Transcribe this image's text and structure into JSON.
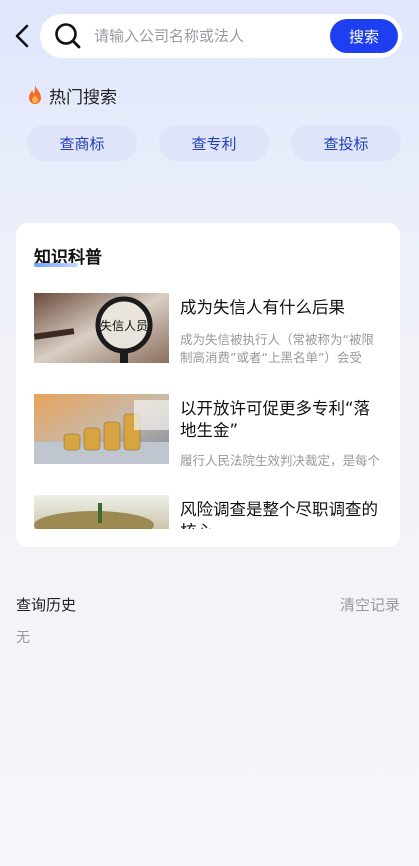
{
  "search": {
    "placeholder": "请输入公司名称或法人",
    "button_label": "搜索"
  },
  "hot": {
    "title": "热门搜索",
    "chips": [
      "查商标",
      "查专利",
      "查投标"
    ]
  },
  "knowledge": {
    "title": "知识科普",
    "articles": [
      {
        "title": "成为失信人有什么后果",
        "excerpt": "成为失信被执行人（常被称为“被限制高消费”或者“上黑名单”）会受",
        "image_text": "失信人员"
      },
      {
        "title": "以开放许可促更多专利“落地生金”",
        "excerpt": "履行人民法院生效判决裁定，是每个公民应尽的义务。"
      },
      {
        "title": "风险调查是整个尽职调查的核心",
        "excerpt": ""
      }
    ]
  },
  "history": {
    "title": "查询历史",
    "clear_label": "清空记录",
    "empty_text": "无"
  },
  "colors": {
    "accent": "#1e3ff0",
    "chip_bg": "#dfe4f8",
    "chip_text": "#1f3fb8"
  }
}
